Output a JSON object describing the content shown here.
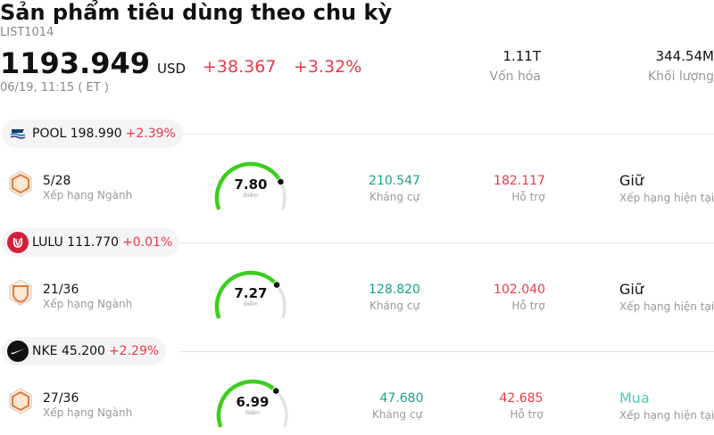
{
  "header": {
    "title": "Sản phẩm tiêu dùng theo chu kỳ",
    "code": "LIST1014",
    "price": "1193.949",
    "currency": "USD",
    "change": "+38.367",
    "change_pct": "+3.32%",
    "timestamp": "06/19, 11:15  ( ET )",
    "market_cap_value": "1.11T",
    "market_cap_label": "Vốn hóa",
    "volume_value": "344.54M",
    "volume_label": "Khối lượng"
  },
  "colors": {
    "up_red": "#e8394a",
    "resistance_green": "#17a28a",
    "buy_teal": "#4fc9b8",
    "gauge_green": "#3ccd1e",
    "gauge_track": "#e2e2e6"
  },
  "stocks": [
    {
      "symbol": "POOL",
      "price": "198.990",
      "change_pct": "+2.39%",
      "logo_icon": "pool-logo-icon",
      "rank": "5/28",
      "rank_label": "Xếp hạng Ngành",
      "score": "7.80",
      "score_fraction": 0.78,
      "score_label": "Điểm",
      "resistance": "210.547",
      "resistance_label": "Kháng cự",
      "support": "182.117",
      "support_label": "Hỗ trợ",
      "rating": "Giữ",
      "rating_label": "Xếp hạng hiện tại"
    },
    {
      "symbol": "LULU",
      "price": "111.770",
      "change_pct": "+0.01%",
      "logo_icon": "lululemon-logo-icon",
      "rank": "21/36",
      "rank_label": "Xếp hạng Ngành",
      "score": "7.27",
      "score_fraction": 0.727,
      "score_label": "Điểm",
      "resistance": "128.820",
      "resistance_label": "Kháng cự",
      "support": "102.040",
      "support_label": "Hỗ trợ",
      "rating": "Giữ",
      "rating_label": "Xếp hạng hiện tại"
    },
    {
      "symbol": "NKE",
      "price": "45.200",
      "change_pct": "+2.29%",
      "logo_icon": "nike-logo-icon",
      "rank": "27/36",
      "rank_label": "Xếp hạng Ngành",
      "score": "6.99",
      "score_fraction": 0.699,
      "score_label": "Điểm",
      "resistance": "47.680",
      "resistance_label": "Kháng cự",
      "support": "42.685",
      "support_label": "Hỗ trợ",
      "rating": "Mua",
      "rating_label": "Xếp hạng hiện tại"
    }
  ]
}
